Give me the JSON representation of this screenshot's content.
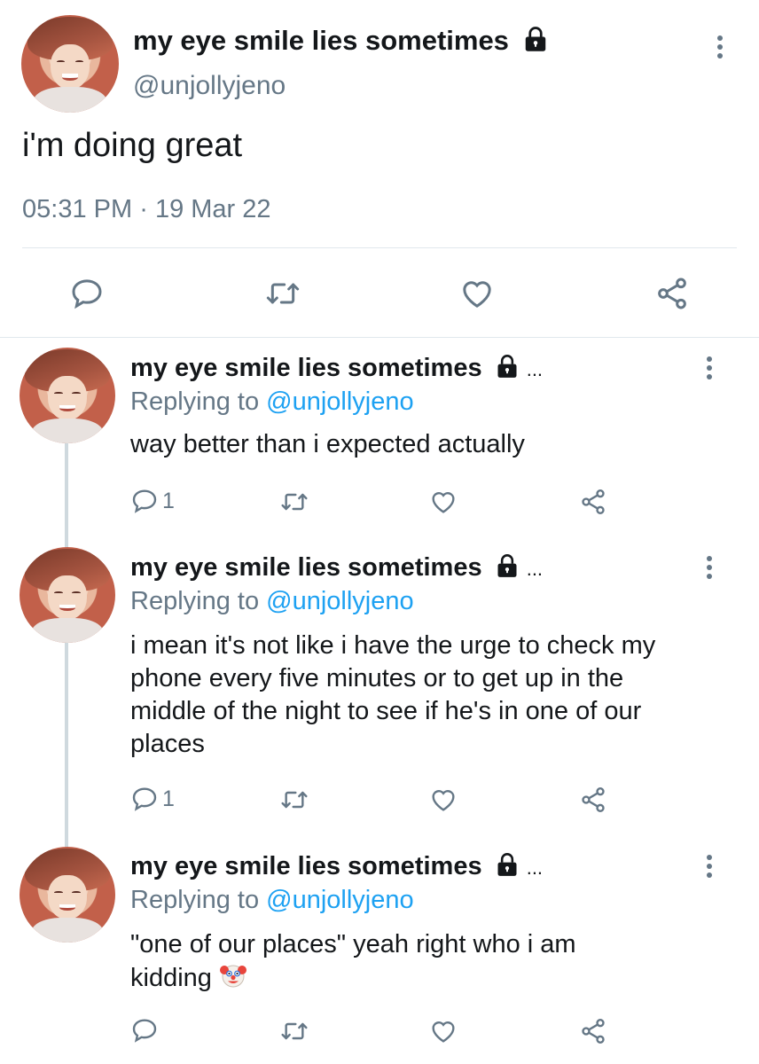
{
  "main_tweet": {
    "display_name": "my eye smile lies sometimes",
    "handle": "@unjollyjeno",
    "text": "i'm doing great",
    "time": "05:31 PM",
    "separator": "·",
    "date": "19 Mar 22",
    "icons": [
      "reply-icon",
      "retweet-icon",
      "like-icon",
      "share-icon"
    ]
  },
  "replies": [
    {
      "display_name": "my eye smile lies sometimes",
      "ellipsis": "...",
      "replying_prefix": "Replying to",
      "replying_handle": "@unjollyjeno",
      "text": "way better than i expected actually",
      "reply_count": "1"
    },
    {
      "display_name": "my eye smile lies sometimes",
      "ellipsis": "...",
      "replying_prefix": "Replying to",
      "replying_handle": "@unjollyjeno",
      "text_lines": [
        "i mean it's not like i have the urge to check my",
        "phone every five minutes or to get up in the",
        "middle of the night to see if he's in one of our",
        "places"
      ],
      "reply_count": "1"
    },
    {
      "display_name": "my eye smile lies sometimes",
      "ellipsis": "...",
      "replying_prefix": "Replying to",
      "replying_handle": "@unjollyjeno",
      "text_lines": [
        "\"one of our places\" yeah right who i am",
        "kidding"
      ],
      "emoji": "clown-face"
    }
  ],
  "colors": {
    "text": "#14171a",
    "secondary": "#657786",
    "link": "#1da1f2",
    "divider": "#e1e8ed"
  }
}
